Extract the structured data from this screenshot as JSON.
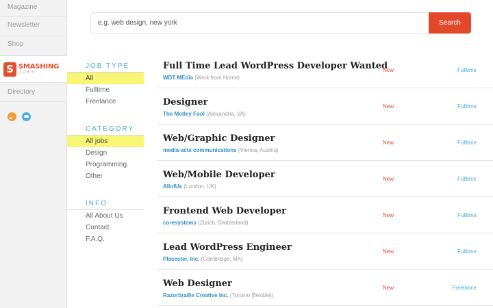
{
  "nav": {
    "magazine": "Magazine",
    "newsletter": "Newsletter",
    "shop": "Shop",
    "logo_text": "SMASHING",
    "logo_sub": "JOBS",
    "directory": "Directory",
    "social_icons": [
      "rss-icon",
      "twitter-icon"
    ]
  },
  "search": {
    "placeholder": "e.g. web design, new york",
    "button_label": "Search"
  },
  "filters": {
    "job_type": {
      "heading": "JOB TYPE",
      "items": [
        {
          "label": "All",
          "selected": true
        },
        {
          "label": "Fulltime",
          "selected": false
        },
        {
          "label": "Freelance",
          "selected": false
        }
      ]
    },
    "category": {
      "heading": "CATEGORY",
      "items": [
        {
          "label": "All jobs",
          "selected": true
        },
        {
          "label": "Design",
          "selected": false
        },
        {
          "label": "Programming",
          "selected": false
        },
        {
          "label": "Other",
          "selected": false
        }
      ]
    },
    "info": {
      "heading": "INFO",
      "items": [
        {
          "label": "All About Us"
        },
        {
          "label": "Contact"
        },
        {
          "label": "F.A.Q."
        }
      ]
    }
  },
  "jobs": [
    {
      "title": "Full Time Lead WordPress Developer Wanted",
      "company": "WDT MEdia",
      "location": "(Work from Home)",
      "status": "New",
      "type": "Fulltime"
    },
    {
      "title": "Designer",
      "company": "The Motley Fool",
      "location": "(Alexandria, VA)",
      "status": "New",
      "type": "Fulltime"
    },
    {
      "title": "Web/Graphic Designer",
      "company": "media-acts communications",
      "location": "(Vienna, Austria)",
      "status": "New",
      "type": "Fulltime"
    },
    {
      "title": "Web/Mobile Developer",
      "company": "AllofUs",
      "location": "(London, UK)",
      "status": "New",
      "type": "Fulltime"
    },
    {
      "title": "Frontend Web Developer",
      "company": "coresystems",
      "location": "(Zurich, Switzerland)",
      "status": "New",
      "type": "Fulltime"
    },
    {
      "title": "Lead WordPress Engineer",
      "company": "Placester, Inc.",
      "location": "(Cambridge, MA)",
      "status": "New",
      "type": "Fulltime"
    },
    {
      "title": "Web Designer",
      "company": "Razorbraille Creative Inc.",
      "location": "(Toronto [flexible])",
      "status": "New",
      "type": "Freelance"
    }
  ],
  "colors": {
    "accent": "#e2492b",
    "link": "#2e8fc8",
    "heading_blue": "#4aa8d6",
    "highlight": "#f8f675"
  }
}
